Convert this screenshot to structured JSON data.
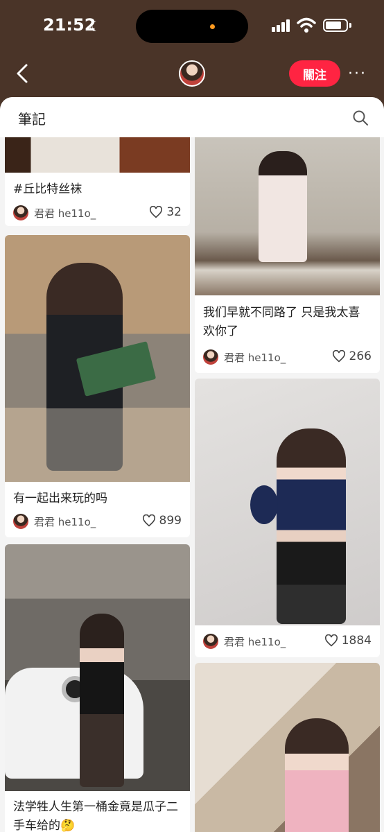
{
  "status": {
    "time": "21:52"
  },
  "header": {
    "follow_label": "關注",
    "more_label": "···"
  },
  "panel": {
    "title": "筆記"
  },
  "cards": [
    {
      "caption": "#丘比特丝袜",
      "author": "君君 he11o_",
      "likes": "32"
    },
    {
      "caption": "我们早就不同路了 只是我太喜欢你了",
      "author": "君君 he11o_",
      "likes": "266"
    },
    {
      "caption": "有一起出来玩的吗",
      "author": "君君 he11o_",
      "likes": "899"
    },
    {
      "caption": "",
      "author": "君君 he11o_",
      "likes": "1884"
    },
    {
      "caption": "法学牲人生第一桶金竟是瓜子二手车给的🤔",
      "author": "",
      "likes": ""
    },
    {
      "caption": "",
      "author": "",
      "likes": ""
    }
  ],
  "colors": {
    "accent": "#ff2442",
    "header_bg": "#4a3428"
  }
}
